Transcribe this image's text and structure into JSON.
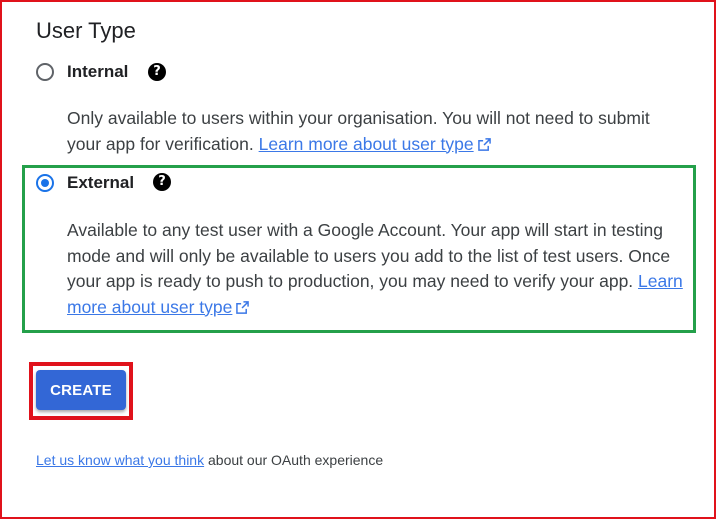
{
  "section": {
    "title": "User Type"
  },
  "options": {
    "internal": {
      "label": "Internal",
      "selected": false,
      "help_icon": "help-circle-icon",
      "description": "Only available to users within your organisation. You will not need to submit your app for verification. ",
      "link_text": "Learn more about user type"
    },
    "external": {
      "label": "External",
      "selected": true,
      "help_icon": "help-circle-icon",
      "description": "Available to any test user with a Google Account. Your app will start in testing mode and will only be available to users you add to the list of test users. Once your app is ready to push to production, you may need to verify your app. ",
      "link_text": "Learn more about user type"
    }
  },
  "actions": {
    "create_label": "CREATE"
  },
  "feedback": {
    "link_text": "Let us know what you think",
    "suffix": " about our OAuth experience"
  },
  "colors": {
    "accent": "#1a73e8",
    "button": "#3367d6",
    "link": "#3b78e7",
    "highlight_green": "#24a04a",
    "highlight_red": "#e0121b"
  }
}
